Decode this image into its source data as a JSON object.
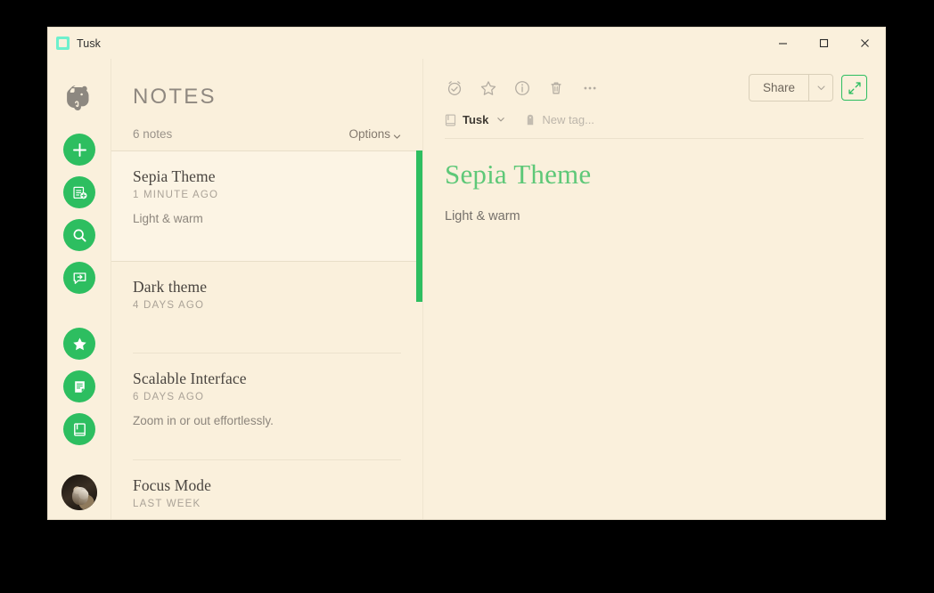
{
  "window": {
    "title": "Tusk",
    "app_icon": "tusk-square-icon",
    "controls": {
      "minimize": "minimize-icon",
      "maximize": "maximize-icon",
      "close": "close-icon"
    }
  },
  "colors": {
    "background": "#faf0dc",
    "accent_green": "#2dbe60",
    "heading_green": "#5ec878",
    "app_icon": "#6ef0cd",
    "muted_text": "#9a938a",
    "title_text": "#4a4540"
  },
  "rail": {
    "logo": "evernote-elephant-logo",
    "buttons": [
      {
        "name": "new-note-button",
        "icon": "plus-icon"
      },
      {
        "name": "new-notebook-button",
        "icon": "note-plus-icon"
      },
      {
        "name": "search-button",
        "icon": "magnifier-icon"
      },
      {
        "name": "share-shortcut-button",
        "icon": "chat-share-icon"
      },
      {
        "name": "shortcuts-button",
        "icon": "star-icon"
      },
      {
        "name": "notes-button",
        "icon": "document-icon"
      },
      {
        "name": "notebooks-button",
        "icon": "book-icon"
      }
    ],
    "avatar": "user-avatar"
  },
  "notelist": {
    "title": "NOTES",
    "count_label": "6 notes",
    "options_label": "Options",
    "options_caret": "chevron-down-icon",
    "scrollbar": "green-scrollbar-thumb",
    "items": [
      {
        "title": "Sepia Theme",
        "date": "1 MINUTE AGO",
        "snippet": "Light & warm",
        "selected": true
      },
      {
        "title": "Dark theme",
        "date": "4 DAYS AGO",
        "snippet": "",
        "selected": false
      },
      {
        "title": "Scalable Interface",
        "date": "6 DAYS AGO",
        "snippet": "Zoom in or out effortlessly.",
        "selected": false
      },
      {
        "title": "Focus Mode",
        "date": "LAST WEEK",
        "snippet": "",
        "selected": false
      }
    ]
  },
  "editor": {
    "toolbar": {
      "icons": [
        {
          "name": "reminder-icon",
          "label": "Reminder"
        },
        {
          "name": "star-icon",
          "label": "Favorite"
        },
        {
          "name": "info-icon",
          "label": "Note info"
        },
        {
          "name": "trash-icon",
          "label": "Delete"
        },
        {
          "name": "more-options-icon",
          "label": "More"
        }
      ],
      "share_label": "Share",
      "share_caret": "chevron-down-icon",
      "expand_icon": "expand-arrows-icon"
    },
    "meta": {
      "notebook_icon": "notebook-icon",
      "notebook_name": "Tusk",
      "notebook_caret": "chevron-down-icon",
      "tag_icon": "tag-icon",
      "tag_placeholder": "New tag..."
    },
    "note": {
      "heading": "Sepia Theme",
      "body": "Light & warm"
    }
  }
}
